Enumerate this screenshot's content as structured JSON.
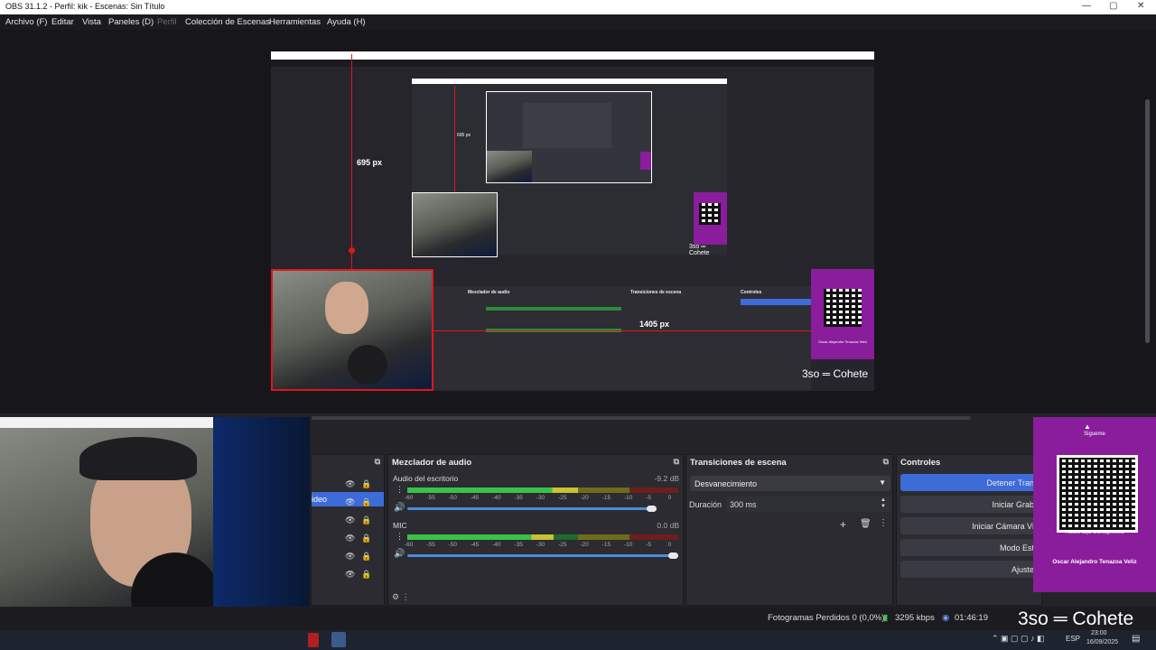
{
  "window": {
    "title": "OBS 31.1.2 - Perfil: kik - Escenas: Sin Título",
    "minimize": "—",
    "maximize": "▢",
    "close": "✕"
  },
  "menu": [
    {
      "label": "Archivo (F)",
      "enabled": true
    },
    {
      "label": "Editar",
      "enabled": true
    },
    {
      "label": "Vista",
      "enabled": true
    },
    {
      "label": "Paneles (D)",
      "enabled": true
    },
    {
      "label": "Perfil",
      "enabled": false
    },
    {
      "label": "Colección de Escenas",
      "enabled": true
    },
    {
      "label": "Herramientas",
      "enabled": true
    },
    {
      "label": "Ayuda (H)",
      "enabled": true
    }
  ],
  "preview": {
    "height_label": "695 px",
    "width_label": "1405 px",
    "inner_height_label": "695 px",
    "inner_width_label": "1405 px",
    "overlay_text": "3so ═ Cohete",
    "overlay_text_small": "3so ═ Cohete",
    "qr_caption": "Oscar Alejandro Tenazoa Veliz"
  },
  "sources_panel": {
    "partial_label": "ideo"
  },
  "mixer": {
    "title": "Mezclador de audio",
    "channels": [
      {
        "name": "Audio del escritorio",
        "db": "-9.2 dB",
        "level": 0.63,
        "volume": 0.92
      },
      {
        "name": "MIC",
        "db": "0.0 dB",
        "level": 0.54,
        "volume": 1.0
      }
    ],
    "scale": [
      "-60",
      "-55",
      "-50",
      "-45",
      "-40",
      "-35",
      "-30",
      "-25",
      "-20",
      "-15",
      "-10",
      "-5",
      "0"
    ]
  },
  "transitions": {
    "title": "Transiciones de escena",
    "selected": "Desvanecimiento",
    "duration_label": "Duración",
    "duration_value": "300 ms"
  },
  "controls": {
    "title": "Controles",
    "buttons": [
      {
        "label": "Detener Tran",
        "active": true
      },
      {
        "label": "Iniciar Grab",
        "active": false
      },
      {
        "label": "Iniciar Cámara Vi",
        "active": false
      },
      {
        "label": "Modo Est",
        "active": false
      },
      {
        "label": "Ajuste",
        "active": false
      }
    ]
  },
  "qr_card": {
    "top_label": "Sigueme",
    "mid_label": "Puedes dejar una sugerencia",
    "name": "Oscar Alejandro Tenazoa Veliz"
  },
  "status": {
    "dropped_frames": "Fotogramas Perdidos 0 (0,0%)",
    "bitrate": "3295 kbps",
    "stream_time": "01:46:19",
    "overlay": "3so ═ Cohete"
  },
  "taskbar": {
    "lang": "ESP",
    "time": "23:00",
    "date": "16/09/2025"
  },
  "colors": {
    "accent": "#3d6bd8",
    "qr_panel": "#8a1d9b",
    "selection": "#e0161a"
  }
}
